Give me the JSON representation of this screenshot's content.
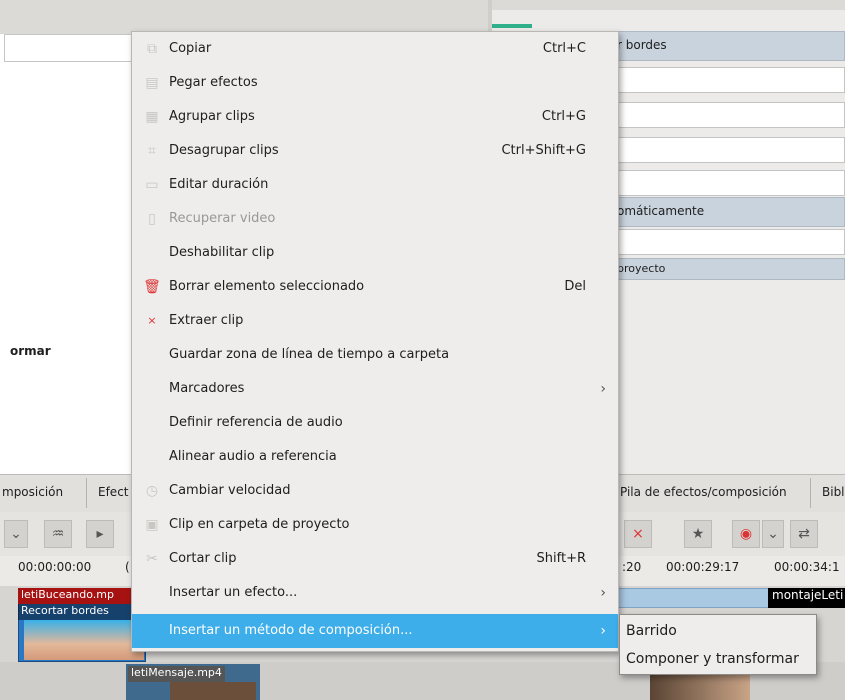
{
  "right_panel": {
    "header1": "r bordes",
    "header2": "omáticamente",
    "header3": "proyecto"
  },
  "left_panel": {
    "label": "ormar"
  },
  "tabs": {
    "left_tab1": "mposición",
    "left_tab2": "Efect",
    "right_tab1": "Pila de efectos/composición",
    "right_tab2": "Bibl"
  },
  "ruler": {
    "t1": "00:00:00:00",
    "t1_suffix": "(",
    "t2": ":20",
    "t3": "00:00:29:17",
    "t4": "00:00:34:1"
  },
  "timeline": {
    "clip1_title": "letiBuceando.mp",
    "clip1_effect": "Recortar bordes",
    "clip2_title": "letiMensaje.mp4",
    "clip3_title": "montajeLeti"
  },
  "context_menu": {
    "items": [
      {
        "label": "Copiar",
        "shortcut": "Ctrl+C",
        "icon": "copy-icon"
      },
      {
        "label": "Pegar efectos",
        "shortcut": "",
        "icon": "paste-icon"
      },
      {
        "label": "Agrupar clips",
        "shortcut": "Ctrl+G",
        "icon": "group-icon"
      },
      {
        "label": "Desagrupar clips",
        "shortcut": "Ctrl+Shift+G",
        "icon": "ungroup-icon"
      },
      {
        "label": "Editar duración",
        "shortcut": "",
        "icon": "duration-icon"
      },
      {
        "label": "Recuperar video",
        "shortcut": "",
        "icon": "document-icon",
        "disabled": true
      },
      {
        "label": "Deshabilitar clip",
        "shortcut": ""
      },
      {
        "label": "Borrar elemento seleccionado",
        "shortcut": "Del",
        "icon": "trash-icon"
      },
      {
        "label": "Extraer clip",
        "shortcut": "",
        "icon": "extract-icon"
      },
      {
        "label": "Guardar zona de línea de tiempo a carpeta",
        "shortcut": ""
      },
      {
        "label": "Marcadores",
        "shortcut": "",
        "submenu": true
      },
      {
        "label": "Definir referencia de audio",
        "shortcut": ""
      },
      {
        "label": "Alinear audio a referencia",
        "shortcut": ""
      },
      {
        "label": "Cambiar velocidad",
        "shortcut": "",
        "icon": "speed-icon"
      },
      {
        "label": "Clip en carpeta de proyecto",
        "shortcut": "",
        "icon": "folder-icon"
      },
      {
        "label": "Cortar clip",
        "shortcut": "Shift+R",
        "icon": "scissors-icon"
      },
      {
        "label": "Insertar un efecto...",
        "shortcut": "",
        "submenu": true
      },
      {
        "label": "Insertar un método de composición...",
        "shortcut": "",
        "submenu": true,
        "highlighted": true
      }
    ]
  },
  "submenu": {
    "items": [
      "Barrido",
      "Componer y transformar"
    ]
  },
  "colors": {
    "highlight": "#3daee9",
    "menu_bg": "#eeedeb",
    "clip_title_red": "#a61212"
  }
}
